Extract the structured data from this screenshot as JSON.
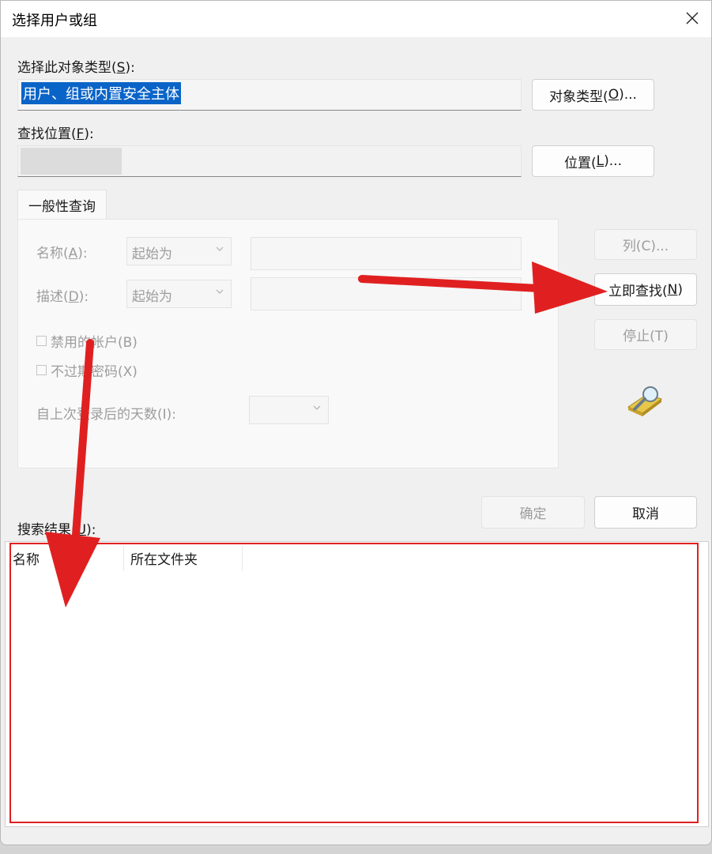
{
  "window": {
    "title": "选择用户或组",
    "close_label": "✕"
  },
  "object_type": {
    "label_prefix": "选择此对象类型(",
    "label_key": "S",
    "label_suffix": "):",
    "value": "用户、组或内置安全主体",
    "button_prefix": "对象类型(",
    "button_key": "O",
    "button_suffix": ")..."
  },
  "location": {
    "label_prefix": "查找位置(",
    "label_key": "F",
    "label_suffix": "):",
    "value": "",
    "button_prefix": "位置(",
    "button_key": "L",
    "button_suffix": ")..."
  },
  "query": {
    "tab_label": "一般性查询",
    "name_label_prefix": "名称(",
    "name_label_key": "A",
    "name_label_suffix": "):",
    "name_mode": "起始为",
    "desc_label_prefix": "描述(",
    "desc_label_key": "D",
    "desc_label_suffix": "):",
    "desc_mode": "起始为",
    "disabled_accounts": "禁用的帐户(B)",
    "non_expiring_pw": "不过期密码(X)",
    "days_since_logon": "自上次登录后的天数(I):"
  },
  "side_buttons": {
    "columns": "列(C)...",
    "find_now_prefix": "立即查找(",
    "find_now_key": "N",
    "find_now_suffix": ")",
    "stop": "停止(T)"
  },
  "footer": {
    "ok": "确定",
    "cancel": "取消"
  },
  "results": {
    "label_prefix": "搜索结果(",
    "label_key": "U",
    "label_suffix": "):",
    "columns": [
      "名称",
      "所在文件夹"
    ]
  },
  "colors": {
    "accent": "#0a64c8",
    "annotation": "#e02020"
  }
}
